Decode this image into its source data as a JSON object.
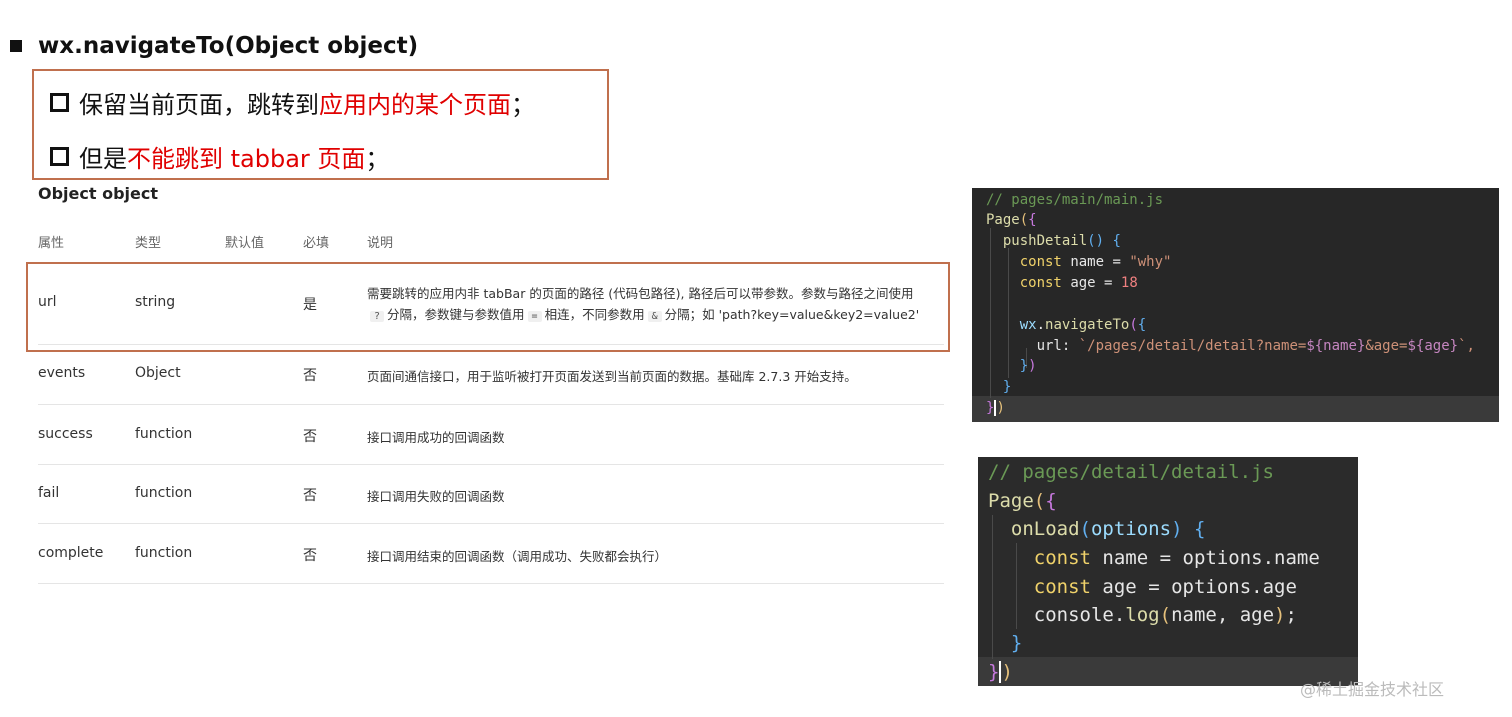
{
  "header": {
    "title": "wx.navigateTo(Object object)"
  },
  "notes": {
    "line1_prefix": "保留当前页面，跳转到",
    "line1_red": "应用内的某个页面",
    "line1_suffix": "；",
    "line2_prefix": "但是",
    "line2_red": "不能跳到 tabbar 页面",
    "line2_suffix": "；"
  },
  "table": {
    "section_title": "Object object",
    "headers": [
      "属性",
      "类型",
      "默认值",
      "必填",
      "说明"
    ],
    "rows": [
      {
        "name": "url",
        "type": "string",
        "default": "",
        "required": "是",
        "desc_line1": "需要跳转的应用内非 tabBar 的页面的路径 (代码包路径), 路径后可以带参数。参数与路径之间使用",
        "desc_line2_parts": [
          "?",
          "分隔，参数键与参数值用",
          "=",
          "相连，不同参数用",
          "&",
          "分隔；如 'path?key=value&key2=value2'"
        ]
      },
      {
        "name": "events",
        "type": "Object",
        "default": "",
        "required": "否",
        "desc": "页面间通信接口，用于监听被打开页面发送到当前页面的数据。基础库 2.7.3 开始支持。"
      },
      {
        "name": "success",
        "type": "function",
        "default": "",
        "required": "否",
        "desc": "接口调用成功的回调函数"
      },
      {
        "name": "fail",
        "type": "function",
        "default": "",
        "required": "否",
        "desc": "接口调用失败的回调函数"
      },
      {
        "name": "complete",
        "type": "function",
        "default": "",
        "required": "否",
        "desc": "接口调用结束的回调函数（调用成功、失败都会执行）"
      }
    ]
  },
  "code_main": {
    "comment": "// pages/main/main.js",
    "page_kw": "Page",
    "method": "pushDetail",
    "const_kw": "const",
    "name_var": "name",
    "name_val": "\"why\"",
    "age_var": "age",
    "age_val": "18",
    "wx_obj": "wx",
    "nav_fn": "navigateTo",
    "url_key": "url:",
    "url_tpl_start": "`/pages/detail/detail?name=",
    "url_interp1": "${name}",
    "url_mid": "&age=",
    "url_interp2": "${age}",
    "url_end": "`,"
  },
  "code_detail": {
    "comment": "// pages/detail/detail.js",
    "page_kw": "Page",
    "method": "onLoad",
    "param": "options",
    "const_kw": "const",
    "name_var": "name",
    "name_src": "options.name",
    "age_var": "age",
    "age_src": "options.age",
    "console": "console",
    "log": "log",
    "log_args": "name, age"
  },
  "watermark": "@稀土掘金技术社区",
  "colors": {
    "highlight_border": "#c0704e",
    "emphasis_red": "#e00000",
    "code_bg": "#272727"
  }
}
